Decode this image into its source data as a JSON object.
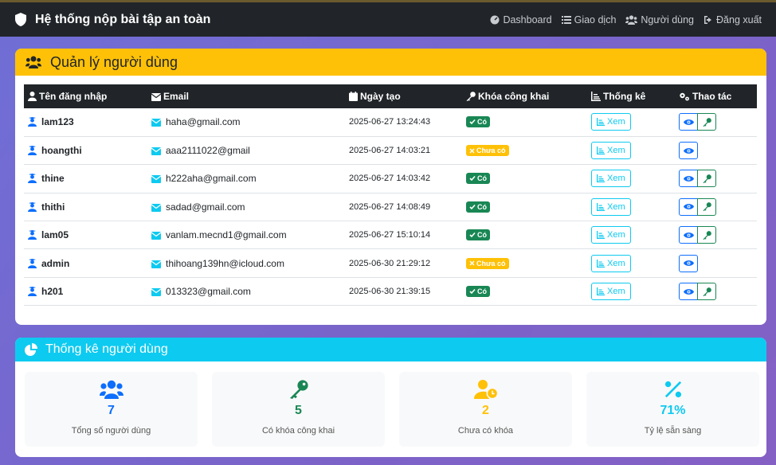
{
  "nav": {
    "brand": "Hệ thống nộp bài tập an toàn",
    "items": [
      {
        "label": "Dashboard",
        "icon": "dashboard-icon"
      },
      {
        "label": "Giao dịch",
        "icon": "list-icon"
      },
      {
        "label": "Người dùng",
        "icon": "users-icon"
      },
      {
        "label": "Đăng xuất",
        "icon": "logout-icon"
      }
    ]
  },
  "users_card": {
    "title": "Quản lý người dùng",
    "columns": [
      "Tên đăng nhập",
      "Email",
      "Ngày tạo",
      "Khóa công khai",
      "Thống kê",
      "Thao tác"
    ],
    "stats_button_label": "Xem",
    "rows": [
      {
        "username": "lam123",
        "email": "haha@gmail.com",
        "created": "2025-06-27 13:24:43",
        "key_status": "Có",
        "has_key": true
      },
      {
        "username": "hoangthi",
        "email": "aaa2111022@gmail",
        "created": "2025-06-27 14:03:21",
        "key_status": "Chưa có",
        "has_key": false
      },
      {
        "username": "thine",
        "email": "h222aha@gmail.com",
        "created": "2025-06-27 14:03:42",
        "key_status": "Có",
        "has_key": true
      },
      {
        "username": "thithi",
        "email": "sadad@gmail.com",
        "created": "2025-06-27 14:08:49",
        "key_status": "Có",
        "has_key": true
      },
      {
        "username": "lam05",
        "email": "vanlam.mecnd1@gmail.com",
        "created": "2025-06-27 15:10:14",
        "key_status": "Có",
        "has_key": true
      },
      {
        "username": "admin",
        "email": "thihoang139hn@icloud.com",
        "created": "2025-06-30 21:29:12",
        "key_status": "Chưa có",
        "has_key": false
      },
      {
        "username": "h201",
        "email": "013323@gmail.com",
        "created": "2025-06-30 21:39:15",
        "key_status": "Có",
        "has_key": true
      }
    ]
  },
  "stats_card": {
    "title": "Thống kê người dùng",
    "items": [
      {
        "value": "7",
        "label": "Tổng số người dùng",
        "color": "#0d6efd",
        "icon": "users-icon"
      },
      {
        "value": "5",
        "label": "Có khóa công khai",
        "color": "#198754",
        "icon": "key-icon"
      },
      {
        "value": "2",
        "label": "Chưa có khóa",
        "color": "#ffc107",
        "icon": "user-clock-icon"
      },
      {
        "value": "71%",
        "label": "Tỷ lệ sẵn sàng",
        "color": "#0dcaf0",
        "icon": "percent-icon"
      }
    ]
  },
  "colors": {
    "navbar": "#212529",
    "users_header": "#ffc107",
    "stats_header": "#0dcaf0",
    "success": "#198754",
    "warning": "#ffc107",
    "primary": "#0d6efd",
    "info": "#0dcaf0"
  }
}
